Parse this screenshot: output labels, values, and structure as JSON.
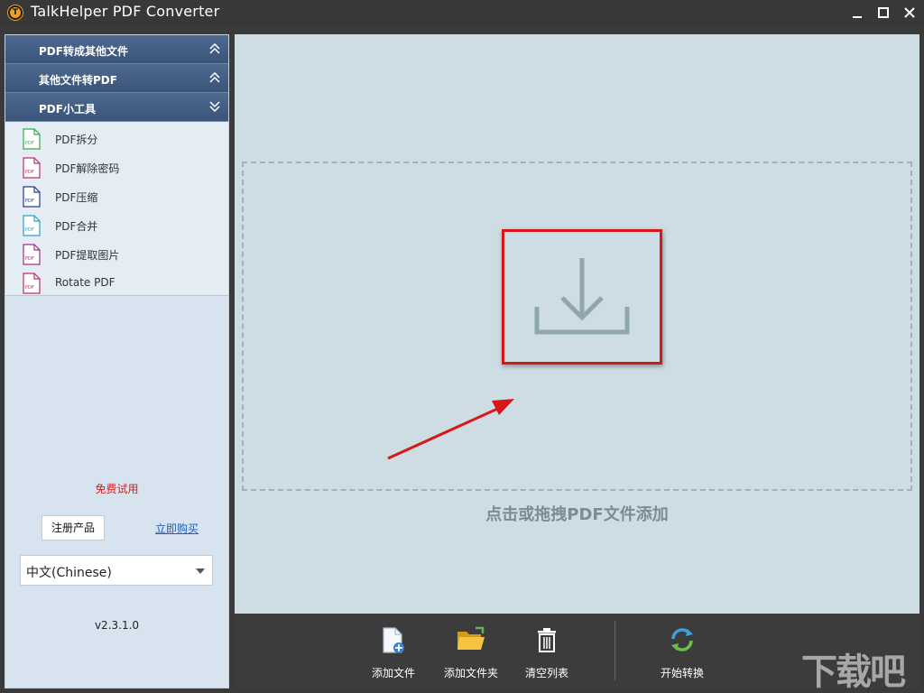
{
  "window": {
    "title": "TalkHelper PDF Converter",
    "logo_letter": "T"
  },
  "sidebar": {
    "sections": [
      {
        "label": "PDF转成其他文件",
        "state": "collapsed"
      },
      {
        "label": "其他文件转PDF",
        "state": "collapsed"
      },
      {
        "label": "PDF小工具",
        "state": "expanded"
      }
    ],
    "tools": [
      {
        "label": "PDF拆分",
        "icon": "pdf-file-green-icon",
        "color": "#3aa64a"
      },
      {
        "label": "PDF解除密码",
        "icon": "pdf-file-pink-icon",
        "color": "#c0306a"
      },
      {
        "label": "PDF压缩",
        "icon": "pdf-file-navy-icon",
        "color": "#2b3a8c"
      },
      {
        "label": "PDF合并",
        "icon": "pdf-file-cyan-icon",
        "color": "#2a9fc8"
      },
      {
        "label": "PDF提取图片",
        "icon": "pdf-file-purple-icon",
        "color": "#a0308a"
      },
      {
        "label": "Rotate PDF",
        "icon": "pdf-file-magenta-icon",
        "color": "#c03060"
      }
    ],
    "file_icon_text": "PDF",
    "free_trial": "免费试用",
    "register_label": "注册产品",
    "buy_label": "立即购买",
    "language": "中文(Chinese)",
    "version": "v2.3.1.0"
  },
  "main": {
    "drop_hint": "点击或拖拽PDF文件添加"
  },
  "toolbar": {
    "add_file": "添加文件",
    "add_folder": "添加文件夹",
    "clear_list": "清空列表",
    "start_convert": "开始转换"
  },
  "watermark": "下载吧",
  "colors": {
    "accent_red": "#d81818",
    "sidebar_header": "#3b5479",
    "main_bg": "#cddde3"
  }
}
